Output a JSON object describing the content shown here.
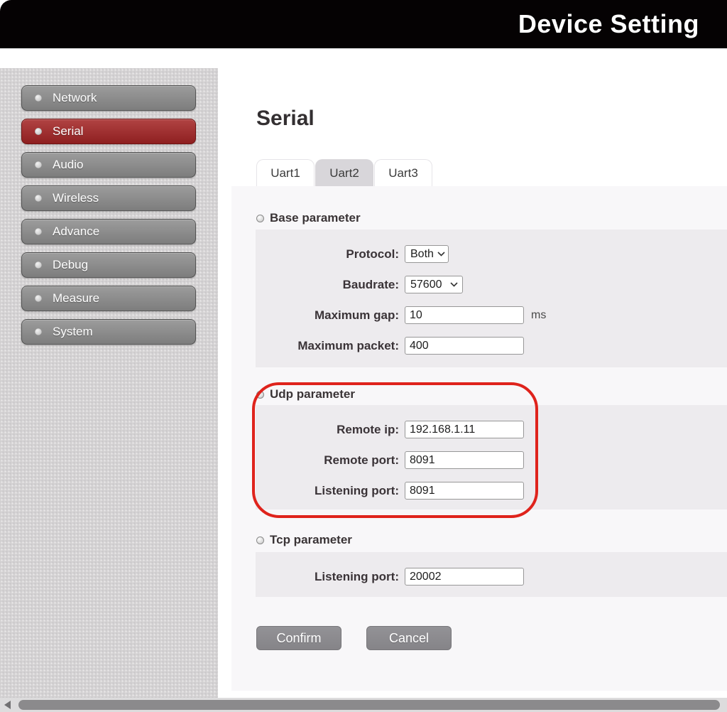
{
  "header": {
    "title": "Device Setting"
  },
  "sidebar": {
    "items": [
      {
        "label": "Network",
        "active": false
      },
      {
        "label": "Serial",
        "active": true
      },
      {
        "label": "Audio",
        "active": false
      },
      {
        "label": "Wireless",
        "active": false
      },
      {
        "label": "Advance",
        "active": false
      },
      {
        "label": "Debug",
        "active": false
      },
      {
        "label": "Measure",
        "active": false
      },
      {
        "label": "System",
        "active": false
      }
    ]
  },
  "main": {
    "title": "Serial",
    "tabs": [
      {
        "label": "Uart1",
        "selected": false
      },
      {
        "label": "Uart2",
        "selected": true
      },
      {
        "label": "Uart3",
        "selected": false
      }
    ],
    "sections": {
      "base": {
        "title": "Base parameter",
        "rows": {
          "protocol": {
            "label": "Protocol:",
            "value": "Both"
          },
          "baudrate": {
            "label": "Baudrate:",
            "value": "57600"
          },
          "max_gap": {
            "label": "Maximum gap:",
            "value": "10",
            "suffix": "ms"
          },
          "max_packet": {
            "label": "Maximum packet:",
            "value": "400"
          }
        }
      },
      "udp": {
        "title": "Udp parameter",
        "highlighted": true,
        "rows": {
          "remote_ip": {
            "label": "Remote ip:",
            "value": "192.168.1.11"
          },
          "remote_port": {
            "label": "Remote port:",
            "value": "8091"
          },
          "listening_port": {
            "label": "Listening port:",
            "value": "8091"
          }
        }
      },
      "tcp": {
        "title": "Tcp parameter",
        "rows": {
          "listening_port": {
            "label": "Listening port:",
            "value": "20002"
          }
        }
      }
    },
    "buttons": {
      "confirm": "Confirm",
      "cancel": "Cancel"
    }
  },
  "colors": {
    "header_bg": "#050203",
    "active_nav": "#8e1f20",
    "nav_gray": "#8c8c8c",
    "panel_bg": "#edebee",
    "tab_selected_bg": "#d8d6da",
    "highlight_red": "#df231c"
  }
}
